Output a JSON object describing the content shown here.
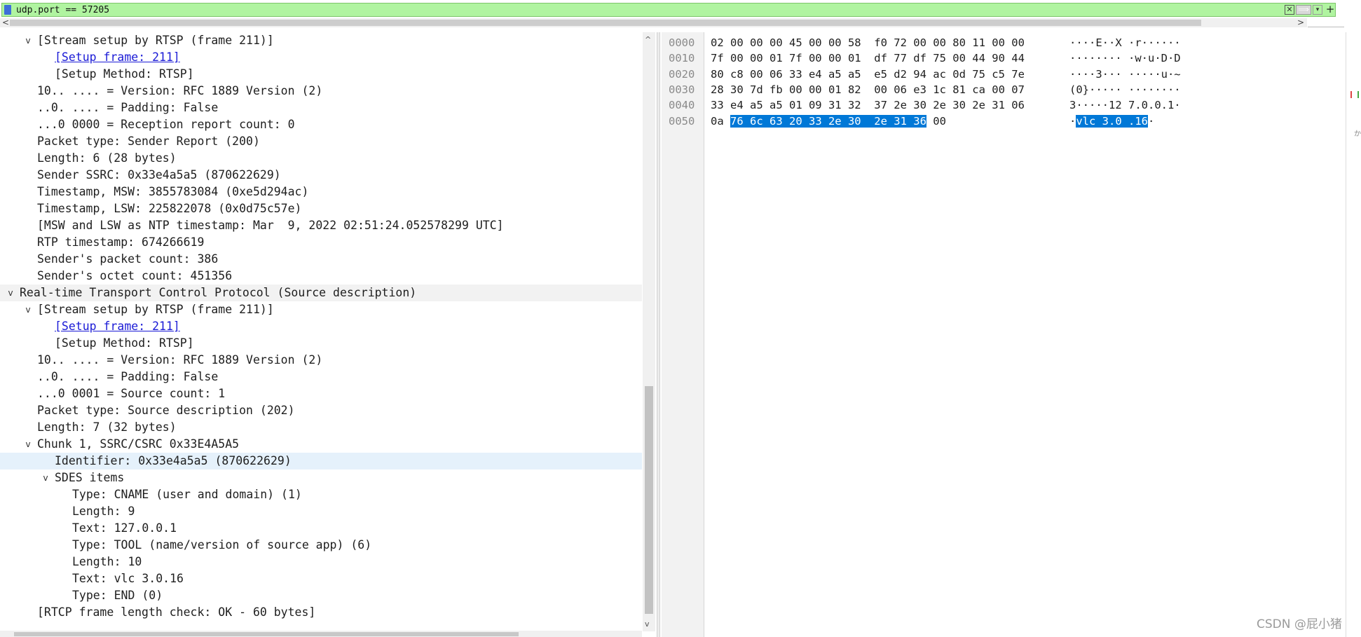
{
  "filter": {
    "value": "udp.port == 57205",
    "clear_glyph": "✕",
    "apply_glyph": "⟹",
    "dropdown_glyph": "▾",
    "add_glyph": "+"
  },
  "scroll_glyphs": {
    "left": "<",
    "right": ">",
    "up": "^",
    "down": "v"
  },
  "details": {
    "rows": [
      {
        "indent": 1,
        "arrow": "v",
        "text": "[Stream setup by RTSP (frame 211)]"
      },
      {
        "indent": 2,
        "arrow": "",
        "text": "[Setup frame: 211]",
        "link": true
      },
      {
        "indent": 2,
        "arrow": "",
        "text": "[Setup Method: RTSP]"
      },
      {
        "indent": 1,
        "arrow": "",
        "text": "10.. .... = Version: RFC 1889 Version (2)"
      },
      {
        "indent": 1,
        "arrow": "",
        "text": "..0. .... = Padding: False"
      },
      {
        "indent": 1,
        "arrow": "",
        "text": "...0 0000 = Reception report count: 0"
      },
      {
        "indent": 1,
        "arrow": "",
        "text": "Packet type: Sender Report (200)"
      },
      {
        "indent": 1,
        "arrow": "",
        "text": "Length: 6 (28 bytes)"
      },
      {
        "indent": 1,
        "arrow": "",
        "text": "Sender SSRC: 0x33e4a5a5 (870622629)"
      },
      {
        "indent": 1,
        "arrow": "",
        "text": "Timestamp, MSW: 3855783084 (0xe5d294ac)"
      },
      {
        "indent": 1,
        "arrow": "",
        "text": "Timestamp, LSW: 225822078 (0x0d75c57e)"
      },
      {
        "indent": 1,
        "arrow": "",
        "text": "[MSW and LSW as NTP timestamp: Mar  9, 2022 02:51:24.052578299 UTC]"
      },
      {
        "indent": 1,
        "arrow": "",
        "text": "RTP timestamp: 674266619"
      },
      {
        "indent": 1,
        "arrow": "",
        "text": "Sender's packet count: 386"
      },
      {
        "indent": 1,
        "arrow": "",
        "text": "Sender's octet count: 451356"
      },
      {
        "indent": 0,
        "arrow": "v",
        "text": "Real-time Transport Control Protocol (Source description)",
        "section": true
      },
      {
        "indent": 1,
        "arrow": "v",
        "text": "[Stream setup by RTSP (frame 211)]"
      },
      {
        "indent": 2,
        "arrow": "",
        "text": "[Setup frame: 211]",
        "link": true
      },
      {
        "indent": 2,
        "arrow": "",
        "text": "[Setup Method: RTSP]"
      },
      {
        "indent": 1,
        "arrow": "",
        "text": "10.. .... = Version: RFC 1889 Version (2)"
      },
      {
        "indent": 1,
        "arrow": "",
        "text": "..0. .... = Padding: False"
      },
      {
        "indent": 1,
        "arrow": "",
        "text": "...0 0001 = Source count: 1"
      },
      {
        "indent": 1,
        "arrow": "",
        "text": "Packet type: Source description (202)"
      },
      {
        "indent": 1,
        "arrow": "",
        "text": "Length: 7 (32 bytes)"
      },
      {
        "indent": 1,
        "arrow": "v",
        "text": "Chunk 1, SSRC/CSRC 0x33E4A5A5"
      },
      {
        "indent": 2,
        "arrow": "",
        "text": "Identifier: 0x33e4a5a5 (870622629)",
        "selected": true
      },
      {
        "indent": 2,
        "arrow": "v",
        "text": "SDES items"
      },
      {
        "indent": 3,
        "arrow": "",
        "text": "Type: CNAME (user and domain) (1)"
      },
      {
        "indent": 3,
        "arrow": "",
        "text": "Length: 9"
      },
      {
        "indent": 3,
        "arrow": "",
        "text": "Text: 127.0.0.1"
      },
      {
        "indent": 3,
        "arrow": "",
        "text": "Type: TOOL (name/version of source app) (6)"
      },
      {
        "indent": 3,
        "arrow": "",
        "text": "Length: 10"
      },
      {
        "indent": 3,
        "arrow": "",
        "text": "Text: vlc 3.0.16"
      },
      {
        "indent": 3,
        "arrow": "",
        "text": "Type: END (0)"
      },
      {
        "indent": 1,
        "arrow": "",
        "text": "[RTCP frame length check: OK - 60 bytes]"
      }
    ]
  },
  "bytes": {
    "rows": [
      {
        "offset": "0000",
        "hex": "02 00 00 00 45 00 00 58  f0 72 00 00 80 11 00 00",
        "ascii": "····E··X ·r······"
      },
      {
        "offset": "0010",
        "hex": "7f 00 00 01 7f 00 00 01  df 77 df 75 00 44 90 44",
        "ascii": "········ ·w·u·D·D"
      },
      {
        "offset": "0020",
        "hex": "80 c8 00 06 33 e4 a5 a5  e5 d2 94 ac 0d 75 c5 7e",
        "ascii": "····3··· ·····u·~"
      },
      {
        "offset": "0030",
        "hex": "28 30 7d fb 00 00 01 82  00 06 e3 1c 81 ca 00 07",
        "ascii": "(0}····· ········"
      },
      {
        "offset": "0040",
        "hex": "33 e4 a5 a5 01 09 31 32  37 2e 30 2e 30 2e 31 06",
        "ascii": "3·····12 7.0.0.1·"
      },
      {
        "offset": "0050",
        "hex_pre": "0a ",
        "hex_hl": "76 6c 63 20 33 2e 30  2e 31 36",
        "hex_post": " 00",
        "ascii_pre": "·",
        "ascii_hl": "vlc 3.0 .16",
        "ascii_post": "·"
      }
    ]
  },
  "watermark": "CSDN @屁小猪",
  "right_edge_char": "か"
}
